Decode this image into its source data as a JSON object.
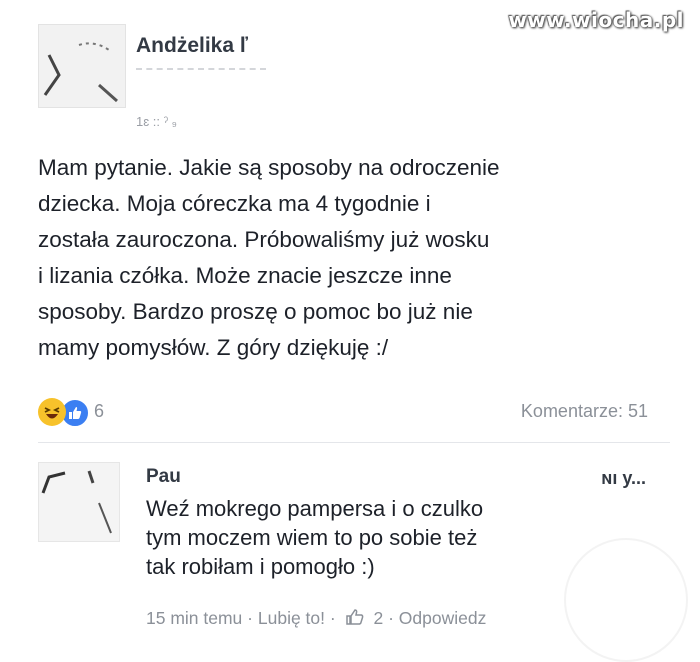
{
  "watermark": "www.wiocha.pl",
  "post": {
    "author": "Andżelika ľ",
    "time": "1ɛ ::  ˀ  ₉",
    "body": "Mam pytanie. Jakie są sposoby na odroczenie\ndziecka. Moja córeczka ma 4 tygodnie i\nzostała zauroczona. Próbowaliśmy już wosku\ni lizania czółka. Może znacie jeszcze inne\nsposoby. Bardzo proszę o pomoc bo już nie\nmamy pomysłów. Z góry dziękuję :/",
    "reactions_count": "6",
    "comments_label": "Komentarze: 51",
    "reaction_icons": [
      "haha-icon",
      "like-icon"
    ]
  },
  "comment": {
    "author": "Pau",
    "author_tail": "ɴı y...",
    "body": "Weź mokrego pampersa  i o czulko\ntym moczem wiem to po sobie też\ntak robiłam i pomogło :)",
    "time": "15 min temu",
    "like_label": "Lubię to!",
    "like_count": "2",
    "reply_label": "Odpowiedz",
    "separator": "·"
  },
  "colors": {
    "text": "#1d2129",
    "meta": "#8b9098",
    "like_blue": "#3b7ff2",
    "haha_yellow": "#f7c22b"
  }
}
